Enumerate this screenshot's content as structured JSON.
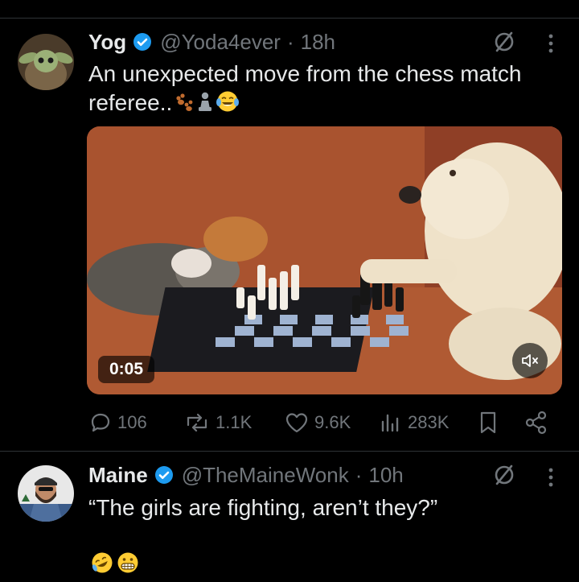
{
  "tweets": [
    {
      "author": {
        "name": "Yog",
        "handle": "@Yoda4ever",
        "time": "18h",
        "verified": true
      },
      "text_line1": "An unexpected move from the chess match",
      "text_line2": "referee..",
      "text_emojis": [
        "paw-prints",
        "chess-pawn",
        "face-with-tears-of-joy"
      ],
      "media": {
        "type": "video",
        "duration": "0:05",
        "muted": true
      },
      "stats": {
        "replies": "106",
        "reposts": "1.1K",
        "likes": "9.6K",
        "views": "283K"
      }
    },
    {
      "author": {
        "name": "Maine",
        "handle": "@TheMaineWonk",
        "time": "10h",
        "verified": true
      },
      "text_line1": "“The girls are fighting, aren’t they?”",
      "text_emojis": [
        "rolling-on-the-floor-laughing",
        "grimacing-face"
      ]
    }
  ],
  "colors": {
    "background": "#000000",
    "text": "#e7e9ea",
    "muted": "#71767b",
    "verified": "#1d9bf0",
    "divider": "#2f3336"
  },
  "icons": [
    "grok-icon",
    "more-icon",
    "reply-icon",
    "repost-icon",
    "like-icon",
    "views-icon",
    "bookmark-icon",
    "share-icon",
    "mute-icon"
  ]
}
